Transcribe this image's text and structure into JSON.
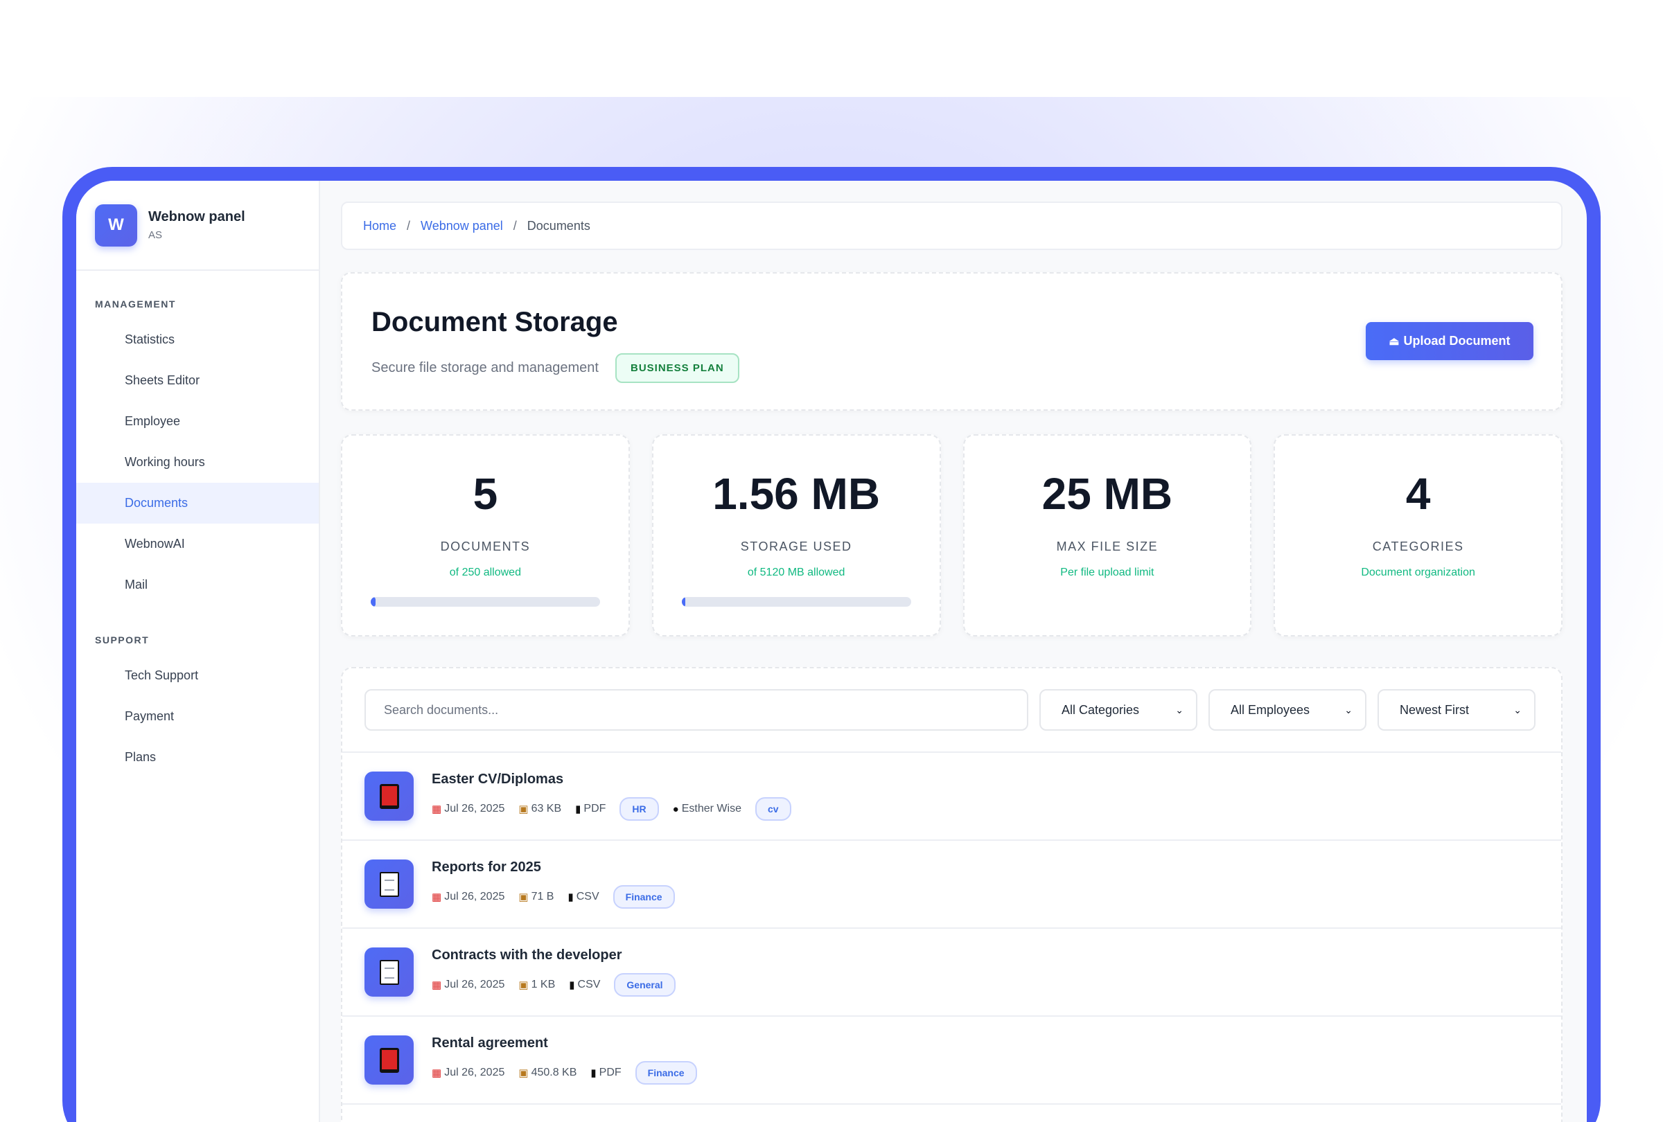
{
  "brand": {
    "logo_letter": "W",
    "name": "Webnow panel",
    "sub": "AS"
  },
  "sidebar": {
    "management_label": "MANAGEMENT",
    "management_items": [
      {
        "label": "Statistics"
      },
      {
        "label": "Sheets Editor"
      },
      {
        "label": "Employee"
      },
      {
        "label": "Working hours"
      },
      {
        "label": "Documents",
        "active": true
      },
      {
        "label": "WebnowAI"
      },
      {
        "label": "Mail"
      }
    ],
    "support_label": "SUPPORT",
    "support_items": [
      {
        "label": "Tech Support"
      },
      {
        "label": "Payment"
      },
      {
        "label": "Plans"
      }
    ]
  },
  "breadcrumb": {
    "home": "Home",
    "panel": "Webnow panel",
    "current": "Documents",
    "sep": "/"
  },
  "header": {
    "title": "Document Storage",
    "subtitle": "Secure file storage and management",
    "plan_badge": "BUSINESS PLAN",
    "upload_label": "Upload Document"
  },
  "stats": [
    {
      "value": "5",
      "label": "DOCUMENTS",
      "note": "of 250 allowed",
      "progress": 0.02
    },
    {
      "value": "1.56 MB",
      "label": "STORAGE USED",
      "note": "of 5120 MB allowed",
      "progress": 0.0003
    },
    {
      "value": "25 MB",
      "label": "MAX FILE SIZE",
      "note": "Per file upload limit"
    },
    {
      "value": "4",
      "label": "CATEGORIES",
      "note": "Document organization"
    }
  ],
  "filters": {
    "search_placeholder": "Search documents...",
    "category": "All Categories",
    "employee": "All Employees",
    "sort": "Newest First"
  },
  "documents": [
    {
      "title": "Easter CV/Diplomas",
      "date": "Jul 26, 2025",
      "size": "63 KB",
      "type": "PDF",
      "category": "HR",
      "employee": "Esther Wise",
      "tag": "cv",
      "icon": "pdf-book-icon"
    },
    {
      "title": "Reports for 2025",
      "date": "Jul 26, 2025",
      "size": "71 B",
      "type": "CSV",
      "category": "Finance",
      "icon": "file-icon"
    },
    {
      "title": "Contracts with the developer",
      "date": "Jul 26, 2025",
      "size": "1 KB",
      "type": "CSV",
      "category": "General",
      "icon": "file-icon"
    },
    {
      "title": "Rental agreement",
      "date": "Jul 26, 2025",
      "size": "450.8 KB",
      "type": "PDF",
      "category": "Finance",
      "icon": "pdf-book-icon"
    }
  ],
  "colors": {
    "accent": "#4a6cf7",
    "frame": "#4a5cf5",
    "success": "#10b981"
  }
}
